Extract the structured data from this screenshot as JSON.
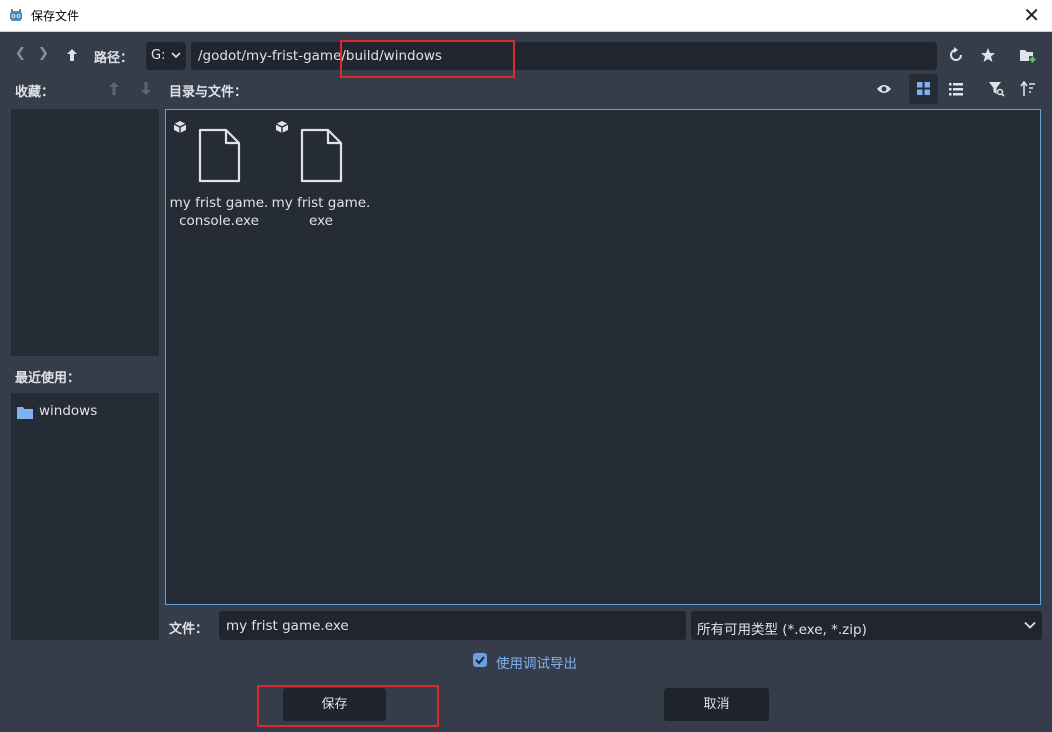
{
  "window": {
    "title": "保存文件",
    "close_glyph": "✕"
  },
  "toolbar": {
    "back_glyph": "❮",
    "forward_glyph": "❯",
    "up_glyph": "🡡",
    "path_label": "路径：",
    "drive": "G:",
    "path": "/godot/my-frist-game/build/windows"
  },
  "favorites": {
    "header": "收藏："
  },
  "recent": {
    "header": "最近使用：",
    "items": [
      {
        "label": "windows"
      }
    ]
  },
  "files": {
    "header": "目录与文件：",
    "items": [
      {
        "line1": "my frist game.",
        "line2": "console.exe"
      },
      {
        "line1": "my frist game.",
        "line2": "exe"
      }
    ]
  },
  "footer": {
    "file_label": "文件：",
    "filename": "my frist game.exe",
    "filter": "所有可用类型 (*.exe, *.zip)",
    "debug_export_label": "使用调试导出",
    "debug_export_checked": true,
    "save_label": "保存",
    "cancel_label": "取消"
  },
  "colors": {
    "background": "#363d4a",
    "panel": "#262c35",
    "input": "#21262e",
    "accent": "#6b9fe0",
    "highlight_box": "#e2262b"
  }
}
